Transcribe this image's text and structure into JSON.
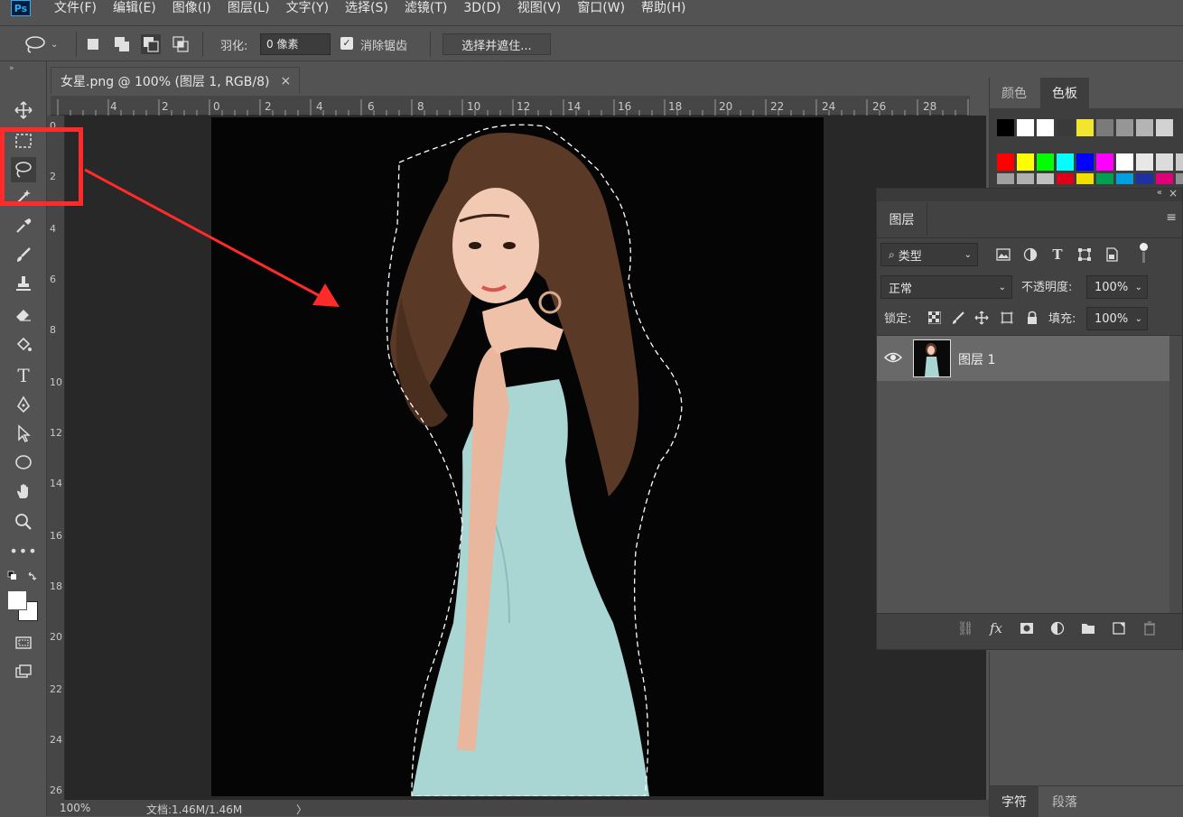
{
  "menu": {
    "logo": "Ps",
    "items": [
      "文件(F)",
      "编辑(E)",
      "图像(I)",
      "图层(L)",
      "文字(Y)",
      "选择(S)",
      "滤镜(T)",
      "3D(D)",
      "视图(V)",
      "窗口(W)",
      "帮助(H)"
    ]
  },
  "options": {
    "feather_label": "羽化:",
    "feather_value": "0 像素",
    "antialias_label": "消除锯齿",
    "antialias_checked": true,
    "select_mask_button": "选择并遮住..."
  },
  "document": {
    "tab_title": "女星.png @ 100% (图层 1, RGB/8)",
    "close_glyph": "×",
    "ruler_top": [
      "4",
      "2",
      "0",
      "2",
      "4",
      "6",
      "8",
      "10",
      "12",
      "14",
      "16",
      "18",
      "20",
      "22",
      "24",
      "26",
      "28"
    ],
    "ruler_left": [
      "0",
      "2",
      "4",
      "6",
      "8",
      "10",
      "12",
      "14",
      "16",
      "18",
      "20",
      "22",
      "24",
      "26"
    ]
  },
  "status": {
    "zoom": "100%",
    "doc_info": "文档:1.46M/1.46M",
    "arrow": "〉"
  },
  "swatch_panel": {
    "tabs": [
      "颜色",
      "色板"
    ],
    "active_tab": "色板",
    "row1": [
      "#000000",
      "#ffffff",
      "#ffffff",
      "#3a3a3a",
      "#f0e630",
      "#7a7a7a",
      "#969696",
      "#b4b4b4",
      "#d2d2d2"
    ],
    "row2": [
      "#ff0000",
      "#ffff00",
      "#00ff00",
      "#00ffff",
      "#0000ff",
      "#ff00ff",
      "#ffffff",
      "#e8e8e8",
      "#dcdcdc",
      "#cccccc"
    ],
    "row3": [
      "#a0a0a0",
      "#b0b0b0",
      "#c0c0c0",
      "#e00018",
      "#f0e000",
      "#00a050",
      "#00a0e0",
      "#2030a0",
      "#e0007a",
      "#909090"
    ]
  },
  "layers_panel": {
    "tab": "图层",
    "filter_kind": "类型",
    "blend_mode": "正常",
    "opacity_label": "不透明度:",
    "opacity_value": "100%",
    "lock_label": "锁定:",
    "fill_label": "填充:",
    "fill_value": "100%",
    "layers": [
      {
        "name": "图层 1",
        "visible": true
      }
    ]
  },
  "lower_panels": {
    "tabs": [
      "字符",
      "段落"
    ]
  },
  "colors": {
    "highlight": "#ff2a2a",
    "dress": "#a9d6d3",
    "ps_blue": "#31a8ff"
  }
}
